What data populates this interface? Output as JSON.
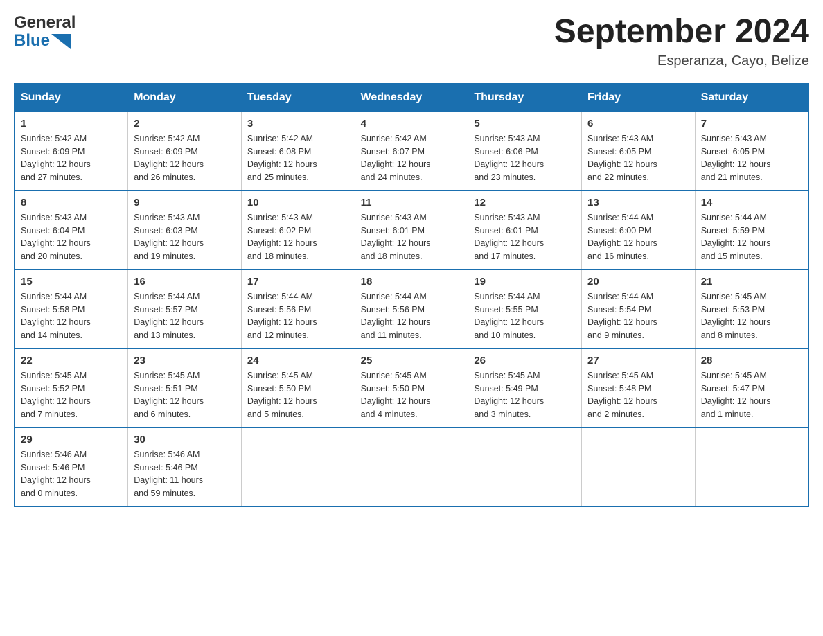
{
  "header": {
    "logo": {
      "general": "General",
      "blue": "Blue"
    },
    "title": "September 2024",
    "subtitle": "Esperanza, Cayo, Belize"
  },
  "weekdays": [
    "Sunday",
    "Monday",
    "Tuesday",
    "Wednesday",
    "Thursday",
    "Friday",
    "Saturday"
  ],
  "weeks": [
    [
      {
        "day": "1",
        "sunrise": "5:42 AM",
        "sunset": "6:09 PM",
        "daylight": "12 hours and 27 minutes."
      },
      {
        "day": "2",
        "sunrise": "5:42 AM",
        "sunset": "6:09 PM",
        "daylight": "12 hours and 26 minutes."
      },
      {
        "day": "3",
        "sunrise": "5:42 AM",
        "sunset": "6:08 PM",
        "daylight": "12 hours and 25 minutes."
      },
      {
        "day": "4",
        "sunrise": "5:42 AM",
        "sunset": "6:07 PM",
        "daylight": "12 hours and 24 minutes."
      },
      {
        "day": "5",
        "sunrise": "5:43 AM",
        "sunset": "6:06 PM",
        "daylight": "12 hours and 23 minutes."
      },
      {
        "day": "6",
        "sunrise": "5:43 AM",
        "sunset": "6:05 PM",
        "daylight": "12 hours and 22 minutes."
      },
      {
        "day": "7",
        "sunrise": "5:43 AM",
        "sunset": "6:05 PM",
        "daylight": "12 hours and 21 minutes."
      }
    ],
    [
      {
        "day": "8",
        "sunrise": "5:43 AM",
        "sunset": "6:04 PM",
        "daylight": "12 hours and 20 minutes."
      },
      {
        "day": "9",
        "sunrise": "5:43 AM",
        "sunset": "6:03 PM",
        "daylight": "12 hours and 19 minutes."
      },
      {
        "day": "10",
        "sunrise": "5:43 AM",
        "sunset": "6:02 PM",
        "daylight": "12 hours and 18 minutes."
      },
      {
        "day": "11",
        "sunrise": "5:43 AM",
        "sunset": "6:01 PM",
        "daylight": "12 hours and 18 minutes."
      },
      {
        "day": "12",
        "sunrise": "5:43 AM",
        "sunset": "6:01 PM",
        "daylight": "12 hours and 17 minutes."
      },
      {
        "day": "13",
        "sunrise": "5:44 AM",
        "sunset": "6:00 PM",
        "daylight": "12 hours and 16 minutes."
      },
      {
        "day": "14",
        "sunrise": "5:44 AM",
        "sunset": "5:59 PM",
        "daylight": "12 hours and 15 minutes."
      }
    ],
    [
      {
        "day": "15",
        "sunrise": "5:44 AM",
        "sunset": "5:58 PM",
        "daylight": "12 hours and 14 minutes."
      },
      {
        "day": "16",
        "sunrise": "5:44 AM",
        "sunset": "5:57 PM",
        "daylight": "12 hours and 13 minutes."
      },
      {
        "day": "17",
        "sunrise": "5:44 AM",
        "sunset": "5:56 PM",
        "daylight": "12 hours and 12 minutes."
      },
      {
        "day": "18",
        "sunrise": "5:44 AM",
        "sunset": "5:56 PM",
        "daylight": "12 hours and 11 minutes."
      },
      {
        "day": "19",
        "sunrise": "5:44 AM",
        "sunset": "5:55 PM",
        "daylight": "12 hours and 10 minutes."
      },
      {
        "day": "20",
        "sunrise": "5:44 AM",
        "sunset": "5:54 PM",
        "daylight": "12 hours and 9 minutes."
      },
      {
        "day": "21",
        "sunrise": "5:45 AM",
        "sunset": "5:53 PM",
        "daylight": "12 hours and 8 minutes."
      }
    ],
    [
      {
        "day": "22",
        "sunrise": "5:45 AM",
        "sunset": "5:52 PM",
        "daylight": "12 hours and 7 minutes."
      },
      {
        "day": "23",
        "sunrise": "5:45 AM",
        "sunset": "5:51 PM",
        "daylight": "12 hours and 6 minutes."
      },
      {
        "day": "24",
        "sunrise": "5:45 AM",
        "sunset": "5:50 PM",
        "daylight": "12 hours and 5 minutes."
      },
      {
        "day": "25",
        "sunrise": "5:45 AM",
        "sunset": "5:50 PM",
        "daylight": "12 hours and 4 minutes."
      },
      {
        "day": "26",
        "sunrise": "5:45 AM",
        "sunset": "5:49 PM",
        "daylight": "12 hours and 3 minutes."
      },
      {
        "day": "27",
        "sunrise": "5:45 AM",
        "sunset": "5:48 PM",
        "daylight": "12 hours and 2 minutes."
      },
      {
        "day": "28",
        "sunrise": "5:45 AM",
        "sunset": "5:47 PM",
        "daylight": "12 hours and 1 minute."
      }
    ],
    [
      {
        "day": "29",
        "sunrise": "5:46 AM",
        "sunset": "5:46 PM",
        "daylight": "12 hours and 0 minutes."
      },
      {
        "day": "30",
        "sunrise": "5:46 AM",
        "sunset": "5:46 PM",
        "daylight": "11 hours and 59 minutes."
      },
      null,
      null,
      null,
      null,
      null
    ]
  ],
  "labels": {
    "sunrise": "Sunrise:",
    "sunset": "Sunset:",
    "daylight": "Daylight:"
  }
}
